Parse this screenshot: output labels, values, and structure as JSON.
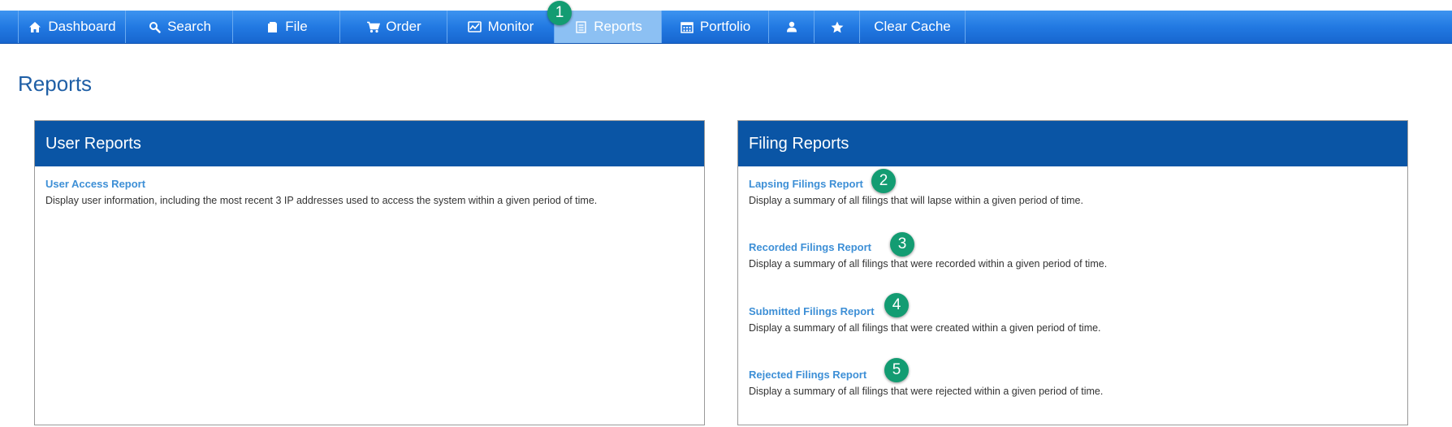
{
  "nav": {
    "items": [
      {
        "id": "dashboard",
        "label": "Dashboard",
        "icon": "home-icon"
      },
      {
        "id": "search",
        "label": "Search",
        "icon": "search-icon"
      },
      {
        "id": "file",
        "label": "File",
        "icon": "file-icon"
      },
      {
        "id": "order",
        "label": "Order",
        "icon": "cart-icon"
      },
      {
        "id": "monitor",
        "label": "Monitor",
        "icon": "monitor-chart-icon"
      },
      {
        "id": "reports",
        "label": "Reports",
        "icon": "document-icon",
        "active": true
      },
      {
        "id": "portfolio",
        "label": "Portfolio",
        "icon": "calendar-icon"
      },
      {
        "id": "user",
        "label": "",
        "icon": "user-icon"
      },
      {
        "id": "favorites",
        "label": "",
        "icon": "star-icon"
      },
      {
        "id": "clear-cache",
        "label": "Clear Cache",
        "icon": ""
      }
    ]
  },
  "page": {
    "title": "Reports"
  },
  "user_reports": {
    "title": "User Reports",
    "items": [
      {
        "name": "User Access Report",
        "description": "Display user information, including the most recent 3 IP addresses used to access the system within a given period of time."
      }
    ]
  },
  "filing_reports": {
    "title": "Filing Reports",
    "items": [
      {
        "name": "Lapsing Filings Report",
        "description": "Display a summary of all filings that will lapse within a given period of time."
      },
      {
        "name": "Recorded Filings Report",
        "description": "Display a summary of all filings that were recorded within a given period of time."
      },
      {
        "name": "Submitted Filings Report",
        "description": "Display a summary of all filings that were created within a given period of time."
      },
      {
        "name": "Rejected Filings Report",
        "description": "Display a summary of all filings that were rejected within a given period of time."
      }
    ]
  },
  "callouts": [
    "1",
    "2",
    "3",
    "4",
    "5"
  ],
  "colors": {
    "nav_bar": "#2279e2",
    "nav_active": "#8cc0f3",
    "panel_header": "#0a55a5",
    "link": "#3d8fd6",
    "title": "#1f5fa6",
    "badge": "#139c72"
  }
}
